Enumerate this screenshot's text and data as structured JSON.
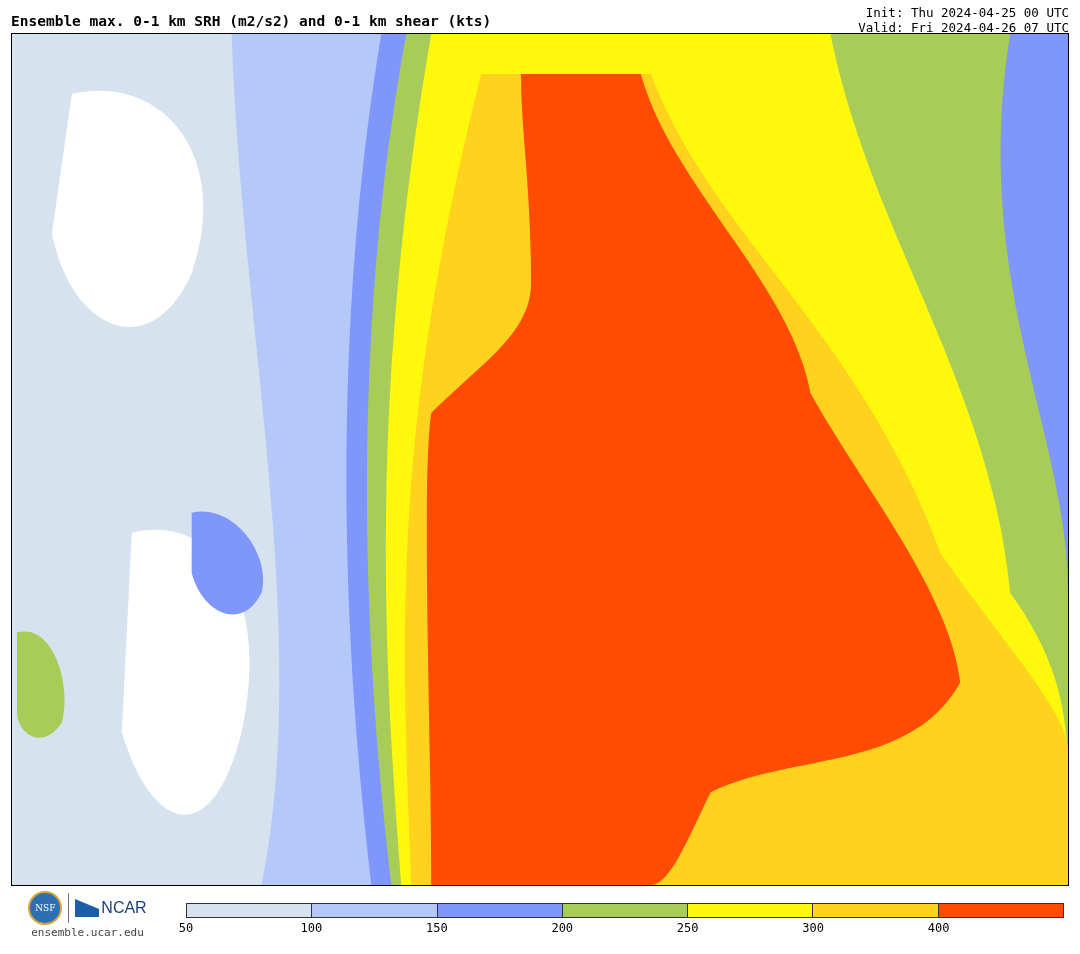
{
  "header": {
    "title": "Ensemble max. 0-1 km SRH (m2/s2) and 0-1 km shear (kts)",
    "init": "Init: Thu 2024-04-25 00 UTC",
    "valid": "Valid: Fri 2024-04-26 07 UTC"
  },
  "branding": {
    "nsf_logo": "NSF",
    "ncar_logo": "NCAR",
    "url": "ensemble.ucar.edu"
  },
  "legend": {
    "segments": [
      {
        "color": "#d6e2ee"
      },
      {
        "color": "#b4c8fa"
      },
      {
        "color": "#7f96fc"
      },
      {
        "color": "#a8cc58"
      },
      {
        "color": "#fef80c"
      },
      {
        "color": "#ffd21e"
      },
      {
        "color": "#ff4c00"
      }
    ],
    "ticks": [
      "50",
      "100",
      "150",
      "200",
      "250",
      "300",
      "400"
    ]
  }
}
